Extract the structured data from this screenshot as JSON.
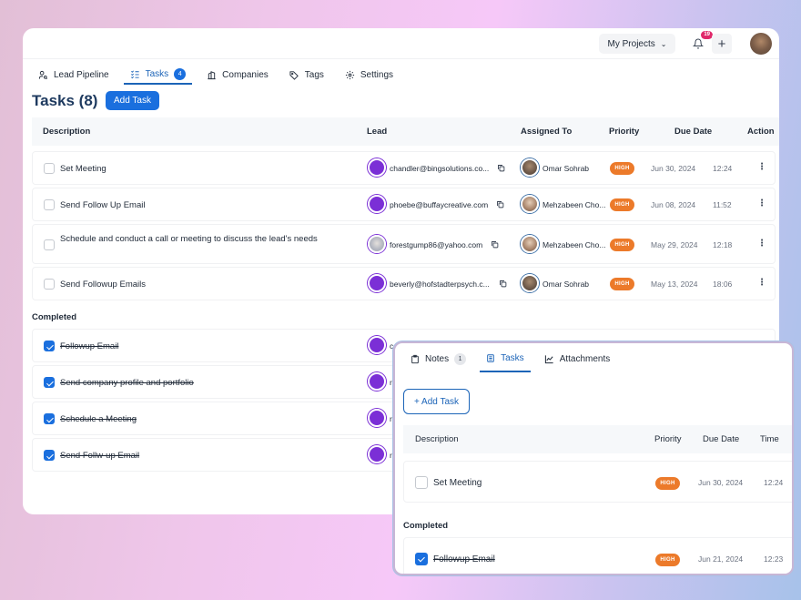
{
  "topbar": {
    "projects_label": "My Projects",
    "notification_count": "19"
  },
  "nav": {
    "items": [
      {
        "label": "Lead Pipeline",
        "icon": "user-search-icon"
      },
      {
        "label": "Tasks",
        "icon": "checklist-icon",
        "badge": "4",
        "active": true
      },
      {
        "label": "Companies",
        "icon": "building-icon"
      },
      {
        "label": "Tags",
        "icon": "tag-icon"
      },
      {
        "label": "Settings",
        "icon": "gear-icon"
      }
    ]
  },
  "page": {
    "title": "Tasks (8)",
    "add_task_label": "Add Task"
  },
  "table": {
    "headers": {
      "description": "Description",
      "lead": "Lead",
      "assigned_to": "Assigned To",
      "priority": "Priority",
      "due_date": "Due Date",
      "action": "Action"
    },
    "open_rows": [
      {
        "description": "Set Meeting",
        "lead_email": "chandler@bingsolutions.co...",
        "assigned_to": "Omar Sohrab",
        "priority": "HIGH",
        "due_date": "Jun 30, 2024",
        "time": "12:24"
      },
      {
        "description": "Send Follow Up Email",
        "lead_email": "phoebe@buffaycreative.com",
        "assigned_to": "Mehzabeen Cho...",
        "priority": "HIGH",
        "due_date": "Jun 08, 2024",
        "time": "11:52"
      },
      {
        "description": "Schedule and conduct a call or meeting to discuss the lead's needs",
        "lead_email": "forestgump86@yahoo.com",
        "assigned_to": "Mehzabeen Cho...",
        "priority": "HIGH",
        "due_date": "May 29, 2024",
        "time": "12:18"
      },
      {
        "description": "Send Followup Emails",
        "lead_email": "beverly@hofstadterpsych.c...",
        "assigned_to": "Omar Sohrab",
        "priority": "HIGH",
        "due_date": "May 13, 2024",
        "time": "18:06"
      }
    ],
    "completed_label": "Completed",
    "completed_rows": [
      {
        "description": "Followup Email",
        "lead_email_partial": "c"
      },
      {
        "description": "Send company profile and portfolio",
        "lead_email_partial": "r"
      },
      {
        "description": "Schedule a Meeting",
        "lead_email_partial": "r"
      },
      {
        "description": "Send Follw-up Email",
        "lead_email_partial": "r"
      }
    ]
  },
  "panel": {
    "tabs": [
      {
        "label": "Notes",
        "badge": "1",
        "icon": "clipboard-icon"
      },
      {
        "label": "Tasks",
        "icon": "document-list-icon",
        "active": true
      },
      {
        "label": "Attachments",
        "icon": "chart-line-icon"
      }
    ],
    "add_task_label": "+ Add Task",
    "headers": {
      "description": "Description",
      "priority": "Priority",
      "due_date": "Due Date",
      "time": "Time"
    },
    "open_rows": [
      {
        "description": "Set Meeting",
        "priority": "HIGH",
        "due_date": "Jun 30, 2024",
        "time": "12:24"
      }
    ],
    "completed_label": "Completed",
    "completed_rows": [
      {
        "description": "Followup Email",
        "priority": "HIGH",
        "due_date": "Jun 21, 2024",
        "time": "12:23"
      }
    ]
  }
}
